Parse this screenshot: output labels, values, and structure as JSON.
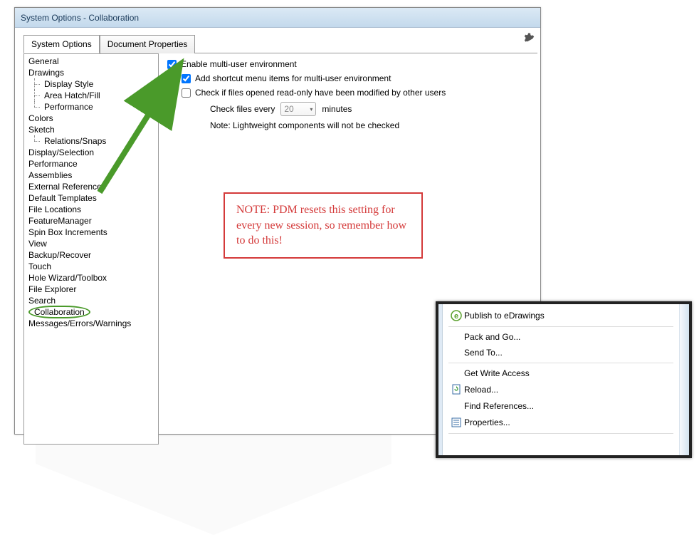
{
  "window": {
    "title": "System Options - Collaboration"
  },
  "tabs": {
    "system_options": "System Options",
    "document_properties": "Document Properties"
  },
  "nav": {
    "items": [
      "General",
      "Drawings",
      "Display Style",
      "Area Hatch/Fill",
      "Performance",
      "Colors",
      "Sketch",
      "Relations/Snaps",
      "Display/Selection",
      "Performance",
      "Assemblies",
      "External References",
      "Default Templates",
      "File Locations",
      "FeatureManager",
      "Spin Box Increments",
      "View",
      "Backup/Recover",
      "Touch",
      "Hole Wizard/Toolbox",
      "File Explorer",
      "Search",
      "Collaboration",
      "Messages/Errors/Warnings"
    ]
  },
  "options": {
    "enable_multi_user": "Enable multi-user environment",
    "add_shortcut": "Add shortcut menu items for multi-user environment",
    "check_readonly": "Check if files opened read-only have been modified by other users",
    "check_every_label": "Check files every",
    "check_every_value": "20",
    "check_every_unit": "minutes",
    "note_lightweight": "Note: Lightweight components will not be checked"
  },
  "callout": {
    "text": "NOTE: PDM resets this setting for every new session, so remember how to do this!"
  },
  "context_menu": {
    "items": [
      "Publish to eDrawings",
      "Pack and Go...",
      "Send To...",
      "Get Write Access",
      "Reload...",
      "Find References...",
      "Properties..."
    ]
  }
}
